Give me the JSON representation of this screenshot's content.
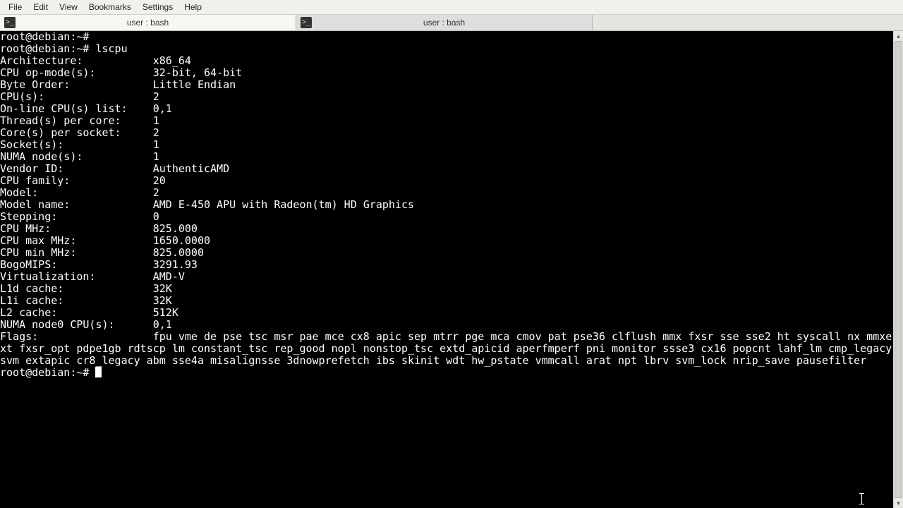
{
  "menubar": {
    "items": [
      "File",
      "Edit",
      "View",
      "Bookmarks",
      "Settings",
      "Help"
    ]
  },
  "tabs": [
    {
      "label": "user : bash",
      "active": true
    },
    {
      "label": "user : bash",
      "active": false
    }
  ],
  "prompt": "root@debian:~#",
  "command": "lscpu",
  "lscpu": {
    "label_width": 24,
    "rows": [
      {
        "k": "Architecture:",
        "v": "x86_64"
      },
      {
        "k": "CPU op-mode(s):",
        "v": "32-bit, 64-bit"
      },
      {
        "k": "Byte Order:",
        "v": "Little Endian"
      },
      {
        "k": "CPU(s):",
        "v": "2"
      },
      {
        "k": "On-line CPU(s) list:",
        "v": "0,1"
      },
      {
        "k": "Thread(s) per core:",
        "v": "1"
      },
      {
        "k": "Core(s) per socket:",
        "v": "2"
      },
      {
        "k": "Socket(s):",
        "v": "1"
      },
      {
        "k": "NUMA node(s):",
        "v": "1"
      },
      {
        "k": "Vendor ID:",
        "v": "AuthenticAMD"
      },
      {
        "k": "CPU family:",
        "v": "20"
      },
      {
        "k": "Model:",
        "v": "2"
      },
      {
        "k": "Model name:",
        "v": "AMD E-450 APU with Radeon(tm) HD Graphics"
      },
      {
        "k": "Stepping:",
        "v": "0"
      },
      {
        "k": "CPU MHz:",
        "v": "825.000"
      },
      {
        "k": "CPU max MHz:",
        "v": "1650.0000"
      },
      {
        "k": "CPU min MHz:",
        "v": "825.0000"
      },
      {
        "k": "BogoMIPS:",
        "v": "3291.93"
      },
      {
        "k": "Virtualization:",
        "v": "AMD-V"
      },
      {
        "k": "L1d cache:",
        "v": "32K"
      },
      {
        "k": "L1i cache:",
        "v": "32K"
      },
      {
        "k": "L2 cache:",
        "v": "512K"
      },
      {
        "k": "NUMA node0 CPU(s):",
        "v": "0,1"
      }
    ],
    "flags_label": "Flags:",
    "flags": "fpu vme de pse tsc msr pae mce cx8 apic sep mtrr pge mca cmov pat pse36 clflush mmx fxsr sse sse2 ht syscall nx mmxext fxsr_opt pdpe1gb rdtscp lm constant_tsc rep_good nopl nonstop_tsc extd_apicid aperfmperf pni monitor ssse3 cx16 popcnt lahf_lm cmp_legacy svm extapic cr8_legacy abm sse4a misalignsse 3dnowprefetch ibs skinit wdt hw_pstate vmmcall arat npt lbrv svm_lock nrip_save pausefilter"
  }
}
